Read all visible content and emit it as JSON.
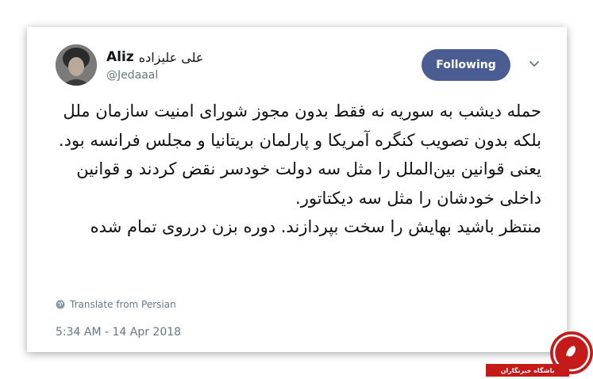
{
  "tweet": {
    "display_name_latin": "Aliz",
    "display_name_fa": "علی علیزاده",
    "handle": "@Jedaaal",
    "follow_label": "Following",
    "text_paragraph_1": "حمله دیشب به سوریه نه فقط بدون مجوز شورای امنیت سازمان ملل بلکه بدون تصویب کنگره آمریکا و پارلمان بریتانیا و مجلس فرانسه بود. یعنی قوانین بین‌الملل را مثل سه دولت خودسر نقض کردند و قوانین داخلی خودشان را مثل سه دیکتاتور.",
    "text_paragraph_2": "منتظر باشید بهایش را سخت بپردازند. دوره بزن درروی تمام شده",
    "translate_label": "Translate from Persian",
    "timestamp": "5:34 AM - 14 Apr 2018"
  },
  "icons": {
    "avatar": "avatar-photo",
    "caret": "chevron-down-icon",
    "translate": "globe-icon"
  },
  "watermark": {
    "label": "باشگاه خبرنگاران"
  },
  "colors": {
    "follow_button": "#4a5d92",
    "secondary_text": "#657786",
    "watermark": "#c41a1a"
  }
}
